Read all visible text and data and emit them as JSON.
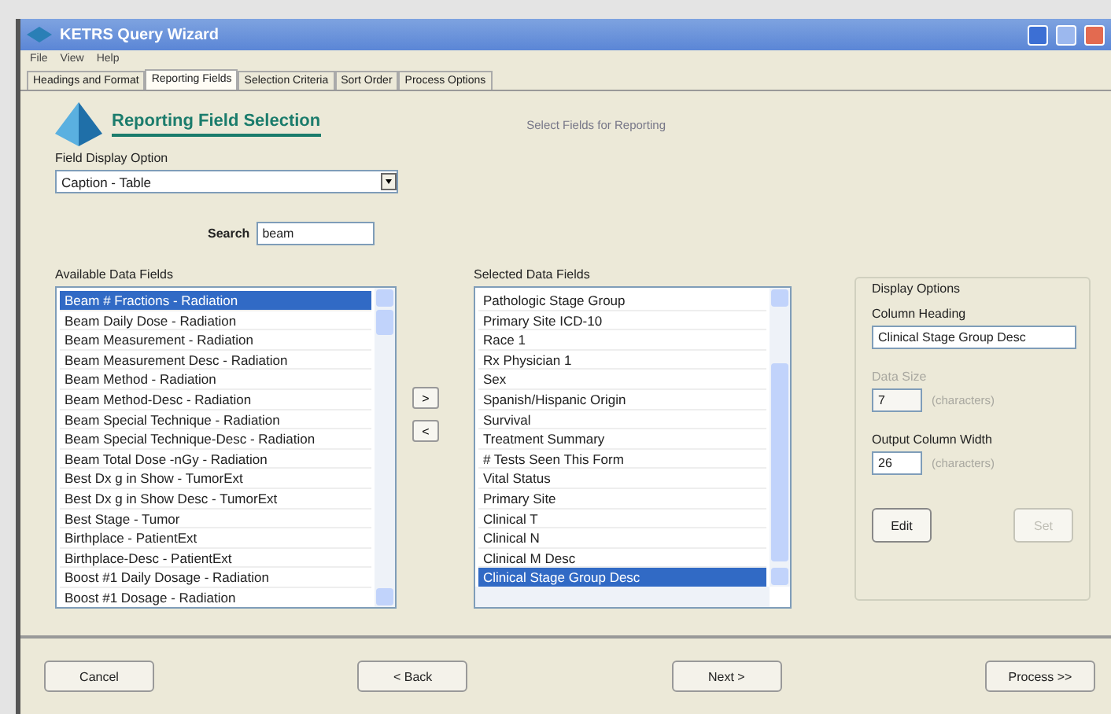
{
  "window": {
    "title": "KETRS Query Wizard"
  },
  "menu": [
    "File",
    "View",
    "Help"
  ],
  "tabs": [
    {
      "label": "Headings and Format",
      "selected": false
    },
    {
      "label": "Reporting Fields",
      "selected": true
    },
    {
      "label": "Selection Criteria",
      "selected": false
    },
    {
      "label": "Sort Order",
      "selected": false
    },
    {
      "label": "Process Options",
      "selected": false
    }
  ],
  "header": {
    "title": "Reporting Field Selection",
    "subtitle": "Select Fields for Reporting"
  },
  "field_display_option": {
    "label": "Field Display Option",
    "value": "Caption - Table"
  },
  "search": {
    "label": "Search",
    "value": "beam"
  },
  "available": {
    "label": "Available Data Fields",
    "items": [
      {
        "text": "Beam # Fractions - Radiation",
        "selected": true
      },
      {
        "text": "Beam Daily Dose - Radiation",
        "selected": false
      },
      {
        "text": "Beam Measurement - Radiation",
        "selected": false
      },
      {
        "text": "Beam Measurement Desc - Radiation",
        "selected": false
      },
      {
        "text": "Beam Method - Radiation",
        "selected": false
      },
      {
        "text": "Beam Method-Desc - Radiation",
        "selected": false
      },
      {
        "text": "Beam Special Technique - Radiation",
        "selected": false
      },
      {
        "text": "Beam Special Technique-Desc - Radiation",
        "selected": false
      },
      {
        "text": "Beam Total Dose -nGy - Radiation",
        "selected": false
      },
      {
        "text": "Best Dx g in Show - TumorExt",
        "selected": false
      },
      {
        "text": "Best Dx g in Show Desc - TumorExt",
        "selected": false
      },
      {
        "text": "Best Stage - Tumor",
        "selected": false
      },
      {
        "text": "Birthplace - PatientExt",
        "selected": false
      },
      {
        "text": "Birthplace-Desc - PatientExt",
        "selected": false
      },
      {
        "text": "Boost #1 Daily Dosage - Radiation",
        "selected": false
      },
      {
        "text": "Boost #1 Dosage - Radiation",
        "selected": false
      }
    ]
  },
  "move_buttons": [
    ">",
    "<"
  ],
  "selected_fields": {
    "label": "Selected Data Fields",
    "items": [
      {
        "text": "Pathologic Stage Group",
        "selected": false
      },
      {
        "text": "Primary Site ICD-10",
        "selected": false
      },
      {
        "text": "Race 1",
        "selected": false
      },
      {
        "text": "Rx Physician 1",
        "selected": false
      },
      {
        "text": "Sex",
        "selected": false
      },
      {
        "text": "Spanish/Hispanic Origin",
        "selected": false
      },
      {
        "text": "Survival",
        "selected": false
      },
      {
        "text": "Treatment Summary",
        "selected": false
      },
      {
        "text": "# Tests Seen This Form",
        "selected": false
      },
      {
        "text": "Vital Status",
        "selected": false
      },
      {
        "text": "Primary Site",
        "selected": false
      },
      {
        "text": "Clinical T",
        "selected": false
      },
      {
        "text": "Clinical N",
        "selected": false
      },
      {
        "text": "Clinical M Desc",
        "selected": false
      },
      {
        "text": "Clinical Stage Group Desc",
        "selected": true
      }
    ]
  },
  "display_options": {
    "title": "Display Options",
    "column_heading": {
      "label": "Column Heading",
      "value": "Clinical Stage Group Desc"
    },
    "data_size": {
      "label": "Data Size",
      "value": "7",
      "unit": "(characters)",
      "disabled": true
    },
    "output_column_width": {
      "label": "Output Column Width",
      "value": "26",
      "unit": "(characters)",
      "disabled": false
    },
    "buttons": [
      {
        "label": "Edit",
        "disabled": false
      },
      {
        "label": "Set",
        "disabled": true
      }
    ]
  },
  "footer_buttons": [
    "Cancel",
    "< Back",
    "Next >",
    "Process >>"
  ]
}
